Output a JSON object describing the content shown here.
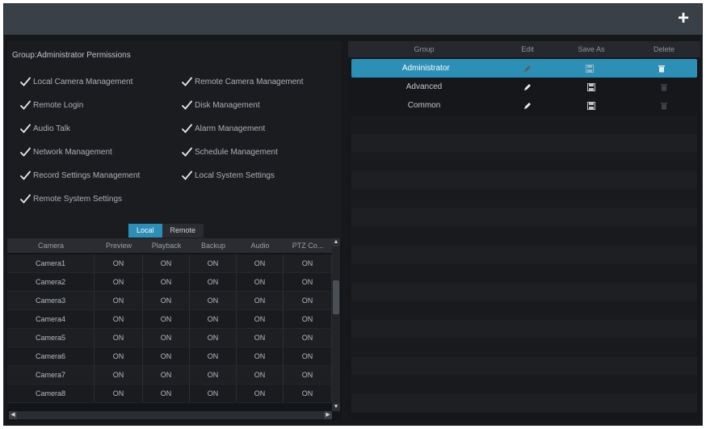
{
  "header": {
    "add_icon": "plus-icon"
  },
  "group_permissions": {
    "title": "Group:Administrator Permissions",
    "items_left": [
      "Local Camera Management",
      "Remote Login",
      "Audio Talk",
      "Network Management",
      "Record Settings Management",
      "Remote System Settings"
    ],
    "items_right": [
      "Remote Camera Management",
      "Disk Management",
      "Alarm Management",
      "Schedule Management",
      "Local System Settings"
    ]
  },
  "tabs": {
    "local": "Local",
    "remote": "Remote"
  },
  "camera_table": {
    "headers": [
      "Camera",
      "Preview",
      "Playback",
      "Backup",
      "Audio",
      "PTZ Co..."
    ],
    "rows": [
      [
        "Camera1",
        "ON",
        "ON",
        "ON",
        "ON",
        "ON"
      ],
      [
        "Camera2",
        "ON",
        "ON",
        "ON",
        "ON",
        "ON"
      ],
      [
        "Camera3",
        "ON",
        "ON",
        "ON",
        "ON",
        "ON"
      ],
      [
        "Camera4",
        "ON",
        "ON",
        "ON",
        "ON",
        "ON"
      ],
      [
        "Camera5",
        "ON",
        "ON",
        "ON",
        "ON",
        "ON"
      ],
      [
        "Camera6",
        "ON",
        "ON",
        "ON",
        "ON",
        "ON"
      ],
      [
        "Camera7",
        "ON",
        "ON",
        "ON",
        "ON",
        "ON"
      ],
      [
        "Camera8",
        "ON",
        "ON",
        "ON",
        "ON",
        "ON"
      ]
    ]
  },
  "group_table": {
    "headers": [
      "Group",
      "Edit",
      "Save As",
      "Delete"
    ],
    "rows": [
      {
        "name": "Administrator",
        "selected": true,
        "edit_enabled": false,
        "delete_enabled": true
      },
      {
        "name": "Advanced",
        "selected": false,
        "edit_enabled": true,
        "delete_enabled": false
      },
      {
        "name": "Common",
        "selected": false,
        "edit_enabled": true,
        "delete_enabled": false
      }
    ],
    "icons": {
      "edit": "pencil-icon",
      "save_as": "save-icon",
      "delete": "trash-icon"
    }
  },
  "colors": {
    "accent": "#2b8fb6",
    "check": "#e6e8ea"
  }
}
